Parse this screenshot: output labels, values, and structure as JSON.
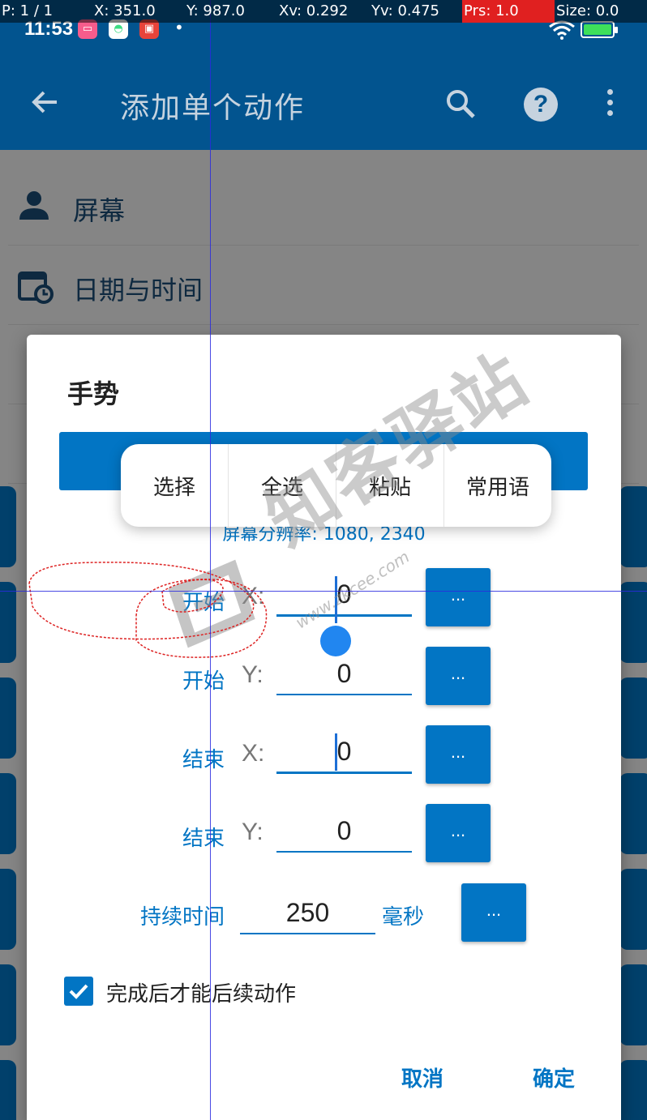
{
  "pointer_info": {
    "p": "P: 1 / 1",
    "x": "X: 351.0",
    "y": "Y: 987.0",
    "xv": "Xv: 0.292",
    "yv": "Yv: 0.475",
    "prs": "Prs: 1.0",
    "size": "Size: 0.0"
  },
  "status_bar": {
    "time": "11:53",
    "icons": [
      "bilibili-app-icon",
      "android-app-icon",
      "toutiao-app-icon"
    ],
    "dot": "•"
  },
  "toolbar": {
    "title": "添加单个动作"
  },
  "background_list": [
    {
      "label": "屏幕",
      "icon": "person-icon"
    },
    {
      "label": "日期与时间",
      "icon": "calendar-clock-icon"
    }
  ],
  "dialog": {
    "title": "手势",
    "resolution": "屏幕分辨率: 1080, 2340",
    "fields": [
      {
        "label": "开始",
        "axis": "X:",
        "value": "0",
        "more": "..."
      },
      {
        "label": "开始",
        "axis": "Y:",
        "value": "0",
        "more": "..."
      },
      {
        "label": "结束",
        "axis": "X:",
        "value": "0",
        "more": "..."
      },
      {
        "label": "结束",
        "axis": "Y:",
        "value": "0",
        "more": "..."
      }
    ],
    "duration": {
      "label": "持续时间",
      "value": "250",
      "unit": "毫秒",
      "more": "..."
    },
    "checkbox": {
      "label": "完成后才能后续动作",
      "checked": true
    },
    "cancel": "取消",
    "ok": "确定"
  },
  "context_menu": {
    "items": [
      "选择",
      "全选",
      "粘贴",
      "常用语"
    ]
  },
  "watermark": {
    "text": "知客驿站",
    "url": "www.zkcee.com"
  },
  "colors": {
    "primary": "#02548f",
    "accent": "#0275c4",
    "pressure_alert": "#e02020"
  }
}
